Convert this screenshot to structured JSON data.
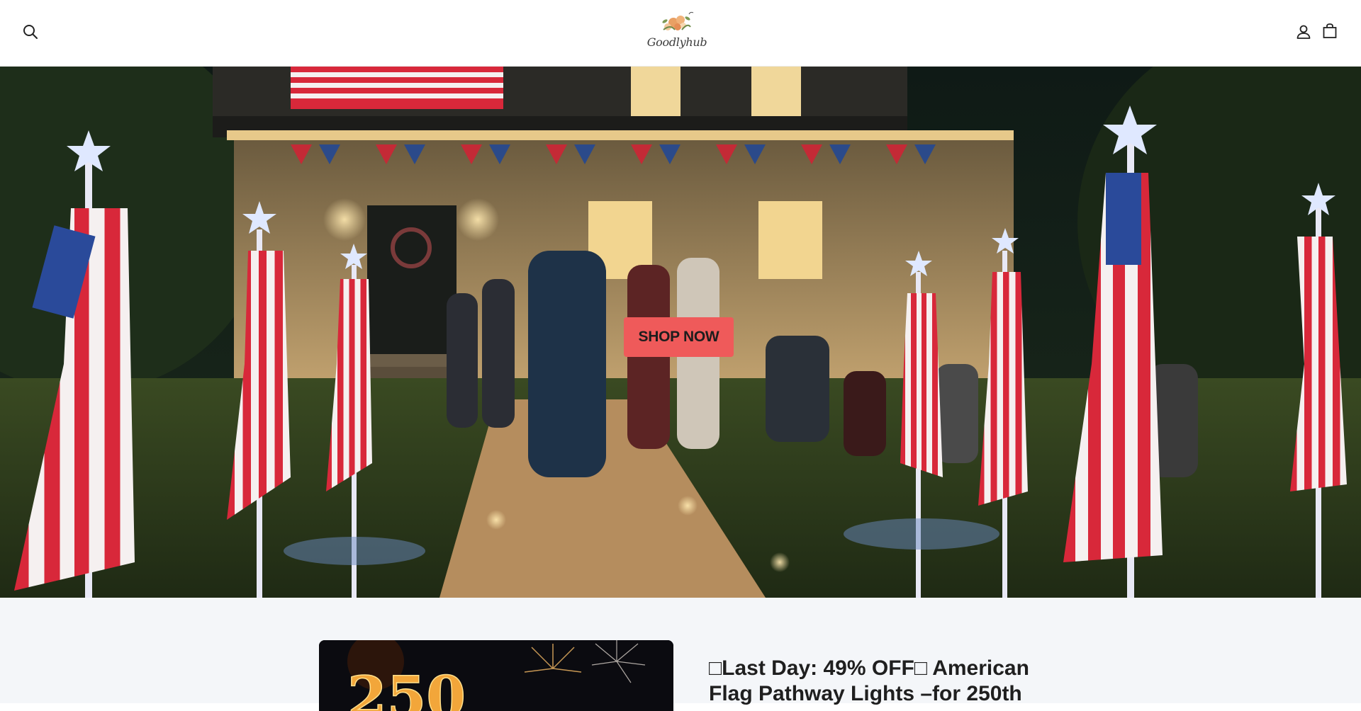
{
  "header": {
    "search_icon": "search-icon",
    "logo_text": "Goodlyhub",
    "account_icon": "account-icon",
    "cart_icon": "cart-icon"
  },
  "hero": {
    "cta_label": "SHOP NOW"
  },
  "product": {
    "image_text": "250",
    "title": "□Last Day: 49% OFF□ American Flag Pathway Lights –for 250th"
  },
  "colors": {
    "cta_background": "#ef5a5a",
    "section_background": "#f4f6f9",
    "header_background": "#ffffff"
  }
}
